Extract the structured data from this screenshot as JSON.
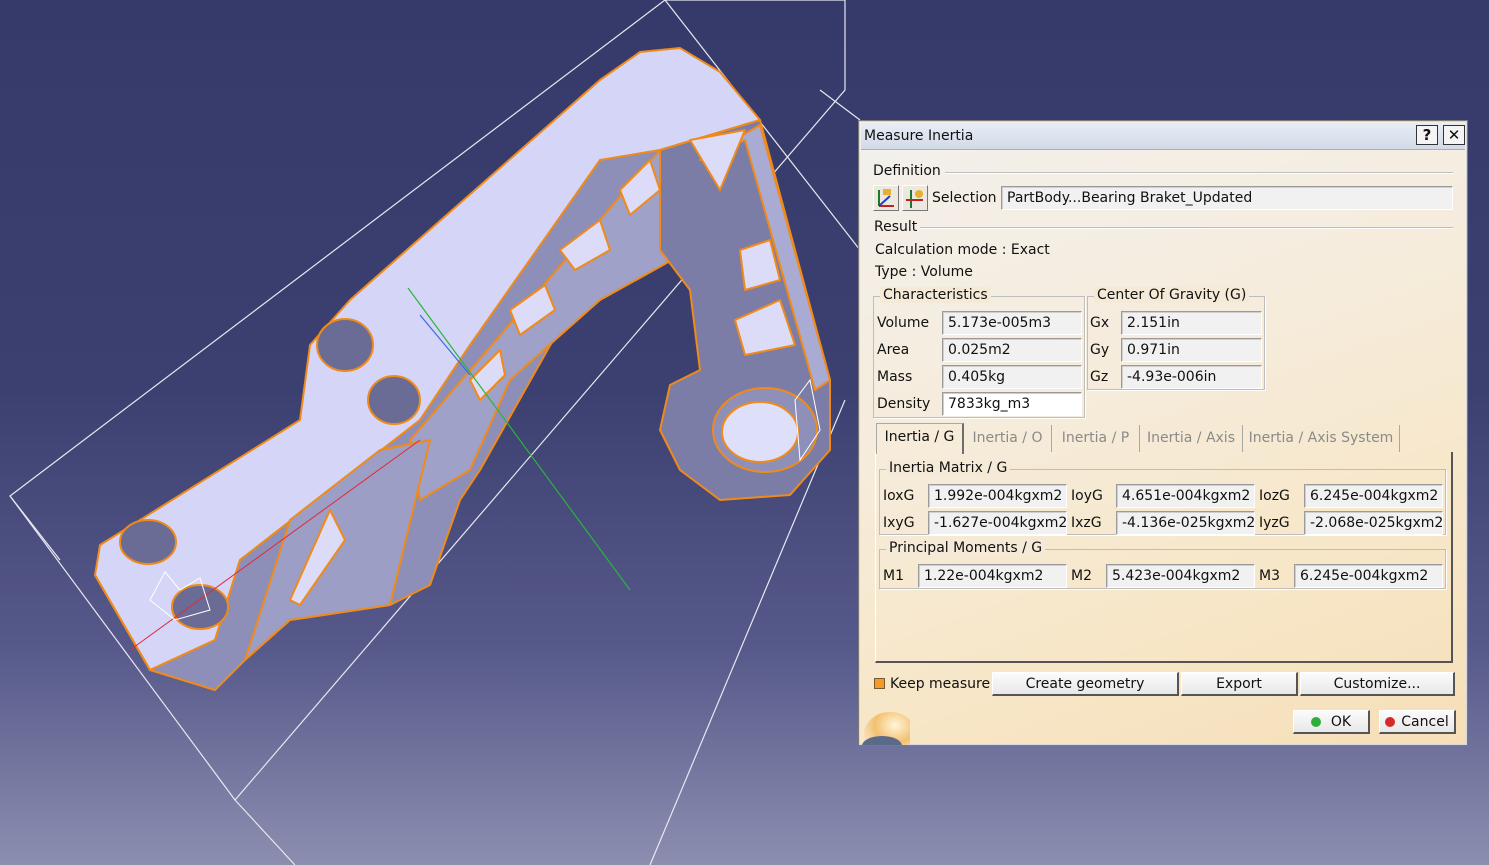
{
  "dialog": {
    "title": "Measure Inertia",
    "help_glyph": "?",
    "close_glyph": "✕",
    "definition_label": "Definition",
    "selection_label": "Selection :",
    "selection_value": "PartBody...Bearing Braket_Updated",
    "result_label": "Result",
    "calc_mode": "Calculation mode :  Exact",
    "type": "Type :  Volume"
  },
  "characteristics": {
    "label": "Characteristics",
    "volume_label": "Volume",
    "volume": "5.173e-005m3",
    "area_label": "Area",
    "area": "0.025m2",
    "mass_label": "Mass",
    "mass": "0.405kg",
    "density_label": "Density",
    "density": "7833kg_m3"
  },
  "cog": {
    "label": "Center Of Gravity (G)",
    "gx_label": "Gx",
    "gx": "2.151in",
    "gy_label": "Gy",
    "gy": "0.971in",
    "gz_label": "Gz",
    "gz": "-4.93e-006in"
  },
  "tabs": [
    "Inertia / G",
    "Inertia / O",
    "Inertia / P",
    "Inertia / Axis",
    "Inertia / Axis System"
  ],
  "matrix": {
    "label": "Inertia Matrix / G",
    "ioxg_label": "IoxG",
    "ioxg": "1.992e-004kgxm2",
    "ioyg_label": "IoyG",
    "ioyg": "4.651e-004kgxm2",
    "iozg_label": "IozG",
    "iozg": "6.245e-004kgxm2",
    "ixyg_label": "IxyG",
    "ixyg": "-1.627e-004kgxm2",
    "ixzg_label": "IxzG",
    "ixzg": "-4.136e-025kgxm2",
    "iyzg_label": "IyzG",
    "iyzg": "-2.068e-025kgxm2"
  },
  "principal": {
    "label": "Principal Moments / G",
    "m1_label": "M1",
    "m1": "1.22e-004kgxm2",
    "m2_label": "M2",
    "m2": "5.423e-004kgxm2",
    "m3_label": "M3",
    "m3": "6.245e-004kgxm2"
  },
  "footer": {
    "keep_measure": "Keep measure",
    "create_geometry": "Create geometry",
    "export": "Export",
    "customize": "Customize...",
    "ok": "OK",
    "cancel": "Cancel"
  },
  "colors": {
    "part_edges": "#f08a1a",
    "part_face": "#d4d4f6",
    "background": "#363a6a",
    "ok_dot": "#2fae3a",
    "cancel_dot": "#d62a2a"
  }
}
